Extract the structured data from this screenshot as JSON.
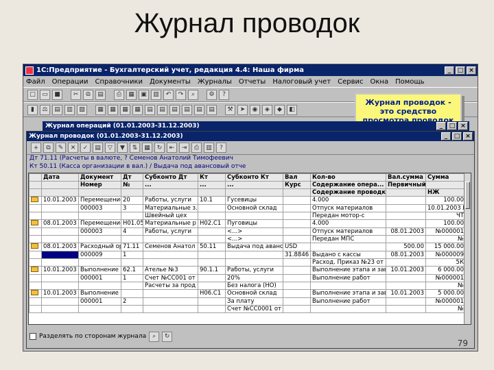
{
  "slide": {
    "title": "Журнал проводок",
    "page_number": "79"
  },
  "app": {
    "title": "1С:Предприятие - Бухгалтерский учет, редакция 4.4: Наша фирма",
    "menu": [
      "Файл",
      "Операции",
      "Справочники",
      "Документы",
      "Журналы",
      "Отчеты",
      "Налоговый учет",
      "Сервис",
      "Окна",
      "Помощь"
    ]
  },
  "callout": {
    "text": "Журнал проводок - это средство просмотра проводок в виде списка"
  },
  "operations_window": {
    "title": "Журнал операций (01.01.2003-31.12.2003)"
  },
  "postings_window": {
    "title": "Журнал проводок (01.01.2003-31.12.2003)",
    "account_lines": [
      "Дт 71.11 (Расчеты в валюте, ? Семенов Анатолий Тимофеевич",
      "Кт 50.11 (Касса организации в вал.) / Выдача под авансовый отче"
    ],
    "columns_row1": [
      "",
      "Дата",
      "Документ",
      "Дт",
      "Субконто Дт",
      "Кт",
      "Субконто Кт",
      "Вал",
      "Кол-во",
      "Вал.сумма",
      "Сумма"
    ],
    "columns_row2": [
      "",
      "",
      "Номер",
      "№",
      "...",
      "...",
      "...",
      "Курс",
      "Содержание опера...",
      "Первичный доку...",
      ""
    ],
    "columns_row3": [
      "",
      "",
      "",
      "",
      "",
      "",
      "",
      "",
      "Содержание проводки",
      "",
      "НЖ"
    ],
    "rows": [
      [
        "",
        "10.01.2003",
        "Перемещение",
        "20",
        "Работы, услуги",
        "10.1",
        "Гусевицы",
        "",
        "4.000",
        "",
        "100.00"
      ],
      [
        "",
        "",
        "000003",
        "3",
        "Материальные з...",
        "",
        "Основной склад",
        "",
        "Отпуск материалов",
        "",
        "10.01.2003 №000001"
      ],
      [
        "",
        "",
        "",
        "",
        "Швейный цех",
        "",
        "",
        "",
        "Передан мотор-с",
        "",
        "ЧТ"
      ],
      [
        "",
        "08.01.2003",
        "Перемещение",
        "Н01.05",
        "Материальные р",
        "Н02.С1",
        "Пуговицы",
        "",
        "4.000",
        "",
        "100.00"
      ],
      [
        "",
        "",
        "000003",
        "4",
        "Работы, услуги",
        "",
        "<...>",
        "",
        "Отпуск материалов",
        "08.01.2003",
        "№000001"
      ],
      [
        "",
        "",
        "",
        "",
        "",
        "",
        "<...>",
        "",
        "Передан МПС",
        "",
        "№"
      ],
      [
        "",
        "08.01.2003",
        "Расходный орд",
        "71.11",
        "Семенов Анатол",
        "50.11",
        "Выдача под авансов",
        "USD",
        "",
        "500.00",
        "15 000.00"
      ],
      [
        "",
        "",
        "000009",
        "1",
        "",
        "",
        "",
        "31.8846",
        "Выдано с кассы",
        "08.01.2003",
        "№000009"
      ],
      [
        "",
        "",
        "",
        "",
        "",
        "",
        "",
        "",
        "Расход. Приказ №23 от 08.01.2003",
        "",
        "5К"
      ],
      [
        "",
        "10.01.2003",
        "Выполнение ст",
        "62.1",
        "Ателье №3",
        "90.1.1",
        "Работы, услуги",
        "",
        "Выполнение этапа и зав",
        "10.01.2003",
        "6 000.00"
      ],
      [
        "",
        "",
        "000001",
        "1",
        "Счет №СС001 от",
        "",
        "20%",
        "",
        "Выполнение работ",
        "",
        "№000001"
      ],
      [
        "",
        "",
        "",
        "",
        "Расчеты за прод",
        "",
        "Без налога (НО)",
        "",
        "",
        "",
        "№"
      ],
      [
        "",
        "10.01.2003",
        "Выполнение ст",
        "",
        "",
        "Н06.С1",
        "Основной склад",
        "",
        "Выполнение этапа и зав",
        "10.01.2003",
        "5 000.00"
      ],
      [
        "",
        "",
        "000001",
        "2",
        "",
        "",
        "За плату",
        "",
        "Выполнение работ",
        "",
        "№000001"
      ],
      [
        "",
        "",
        "",
        "",
        "",
        "",
        "Счет №СС0001 от",
        "",
        "",
        "",
        "№"
      ]
    ],
    "bottom_checkbox_label": "Разделять по сторонам журнала"
  }
}
